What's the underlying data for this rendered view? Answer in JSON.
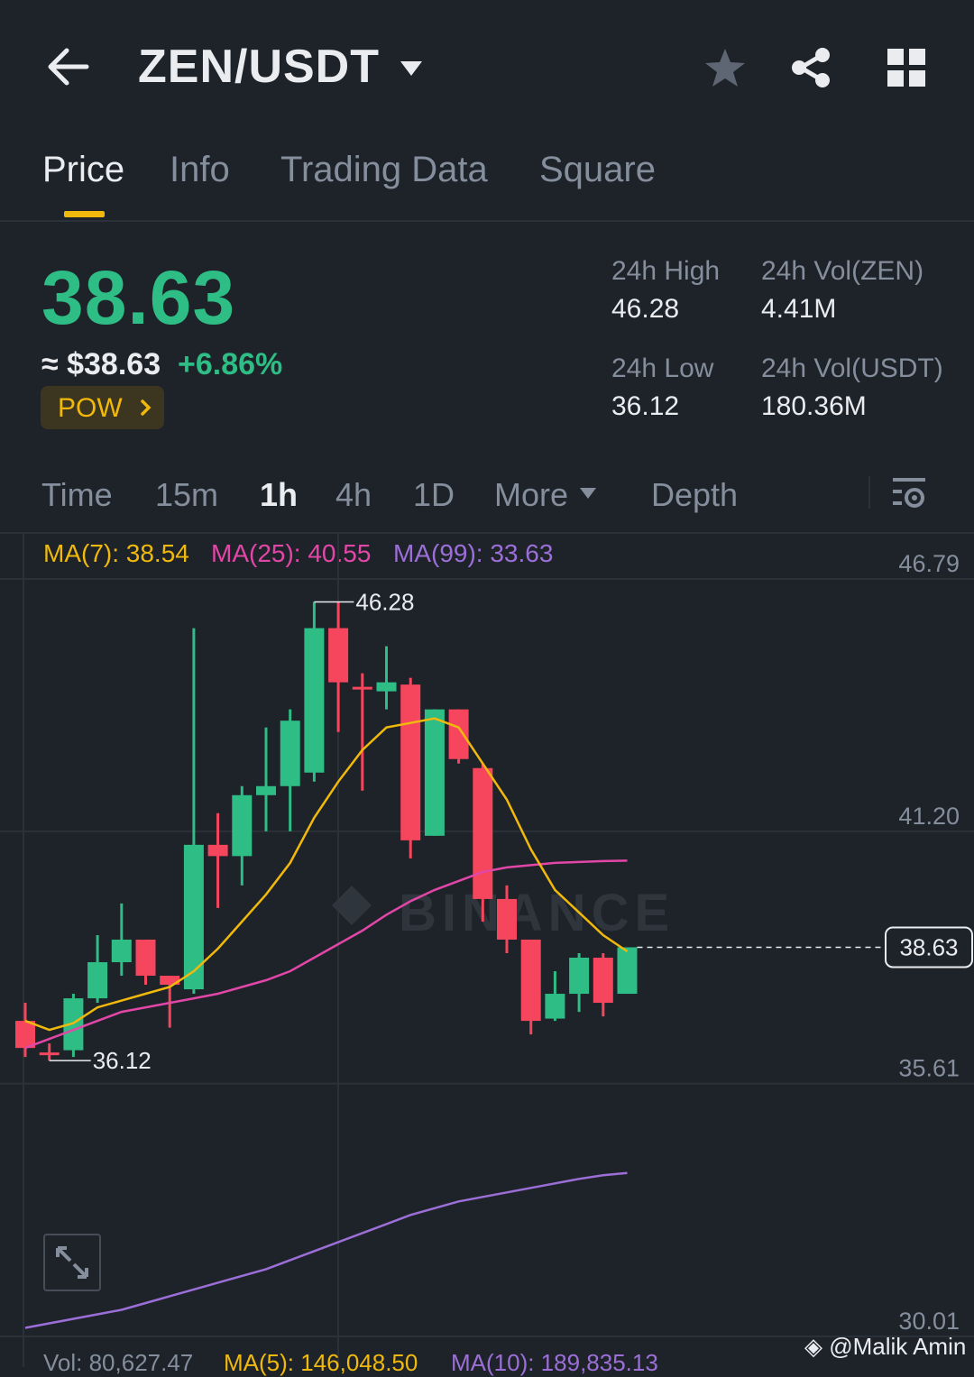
{
  "header": {
    "title": "ZEN/USDT"
  },
  "tabs": [
    {
      "label": "Price",
      "active": true
    },
    {
      "label": "Info"
    },
    {
      "label": "Trading Data"
    },
    {
      "label": "Square"
    }
  ],
  "price": {
    "last": "38.63",
    "approx": "≈ $38.63",
    "change": "+6.86%",
    "tag": "POW"
  },
  "stats": {
    "high_label": "24h High",
    "high_value": "46.28",
    "low_label": "24h Low",
    "low_value": "36.12",
    "vol_zen_label": "24h Vol(ZEN)",
    "vol_zen_value": "4.41M",
    "vol_usdt_label": "24h Vol(USDT)",
    "vol_usdt_value": "180.36M"
  },
  "timeframes": [
    {
      "label": "Time"
    },
    {
      "label": "15m"
    },
    {
      "label": "1h",
      "active": true
    },
    {
      "label": "4h"
    },
    {
      "label": "1D"
    },
    {
      "label": "More"
    },
    {
      "label": "Depth"
    }
  ],
  "indicators": {
    "ma7": "MA(7): 38.54",
    "ma25": "MA(25): 40.55",
    "ma99": "MA(99): 33.63",
    "ma7_color": "#f0b90b",
    "ma25_color": "#e247a8",
    "ma99_color": "#9c6fd8"
  },
  "chart_data": {
    "type": "candlestick",
    "y_axis_ticks": [
      "46.79",
      "41.20",
      "35.61",
      "30.01"
    ],
    "last_price_label": "38.63",
    "high_marker": "46.28",
    "low_marker": "36.12",
    "candles": [
      {
        "o": 37.0,
        "h": 37.4,
        "l": 36.2,
        "c": 36.4
      },
      {
        "o": 36.3,
        "h": 36.5,
        "l": 36.12,
        "c": 36.25
      },
      {
        "o": 36.35,
        "h": 37.6,
        "l": 36.2,
        "c": 37.5
      },
      {
        "o": 37.5,
        "h": 38.9,
        "l": 37.4,
        "c": 38.3
      },
      {
        "o": 38.3,
        "h": 39.6,
        "l": 38.0,
        "c": 38.8
      },
      {
        "o": 38.8,
        "h": 38.8,
        "l": 37.8,
        "c": 38.0
      },
      {
        "o": 38.0,
        "h": 38.0,
        "l": 36.85,
        "c": 37.8
      },
      {
        "o": 37.7,
        "h": 45.7,
        "l": 37.6,
        "c": 40.9
      },
      {
        "o": 40.9,
        "h": 41.6,
        "l": 39.5,
        "c": 40.65
      },
      {
        "o": 40.65,
        "h": 42.2,
        "l": 40.0,
        "c": 42.0
      },
      {
        "o": 42.0,
        "h": 43.5,
        "l": 41.2,
        "c": 42.2
      },
      {
        "o": 42.2,
        "h": 43.9,
        "l": 41.2,
        "c": 43.65
      },
      {
        "o": 42.5,
        "h": 46.28,
        "l": 42.3,
        "c": 45.7
      },
      {
        "o": 45.7,
        "h": 46.28,
        "l": 43.4,
        "c": 44.5
      },
      {
        "o": 44.4,
        "h": 44.7,
        "l": 42.1,
        "c": 44.35
      },
      {
        "o": 44.3,
        "h": 45.3,
        "l": 43.9,
        "c": 44.5
      },
      {
        "o": 44.45,
        "h": 44.6,
        "l": 40.6,
        "c": 41.0
      },
      {
        "o": 41.1,
        "h": 43.9,
        "l": 41.1,
        "c": 43.9
      },
      {
        "o": 43.9,
        "h": 43.9,
        "l": 42.7,
        "c": 42.8
      },
      {
        "o": 42.6,
        "h": 42.7,
        "l": 39.2,
        "c": 39.7
      },
      {
        "o": 39.7,
        "h": 40.0,
        "l": 38.5,
        "c": 38.8
      },
      {
        "o": 38.8,
        "h": 38.8,
        "l": 36.7,
        "c": 37.0
      },
      {
        "o": 37.05,
        "h": 38.1,
        "l": 37.0,
        "c": 37.6
      },
      {
        "o": 37.6,
        "h": 38.5,
        "l": 37.2,
        "c": 38.4
      },
      {
        "o": 38.4,
        "h": 38.5,
        "l": 37.1,
        "c": 37.4
      },
      {
        "o": 37.6,
        "h": 38.63,
        "l": 37.6,
        "c": 38.63
      }
    ],
    "ma7": [
      37.0,
      36.8,
      36.95,
      37.3,
      37.45,
      37.6,
      37.75,
      38.1,
      38.6,
      39.2,
      39.8,
      40.5,
      41.5,
      42.3,
      43.0,
      43.5,
      43.6,
      43.7,
      43.5,
      42.7,
      41.9,
      40.8,
      39.9,
      39.4,
      38.9,
      38.54
    ],
    "ma25": [
      36.4,
      36.6,
      36.8,
      37.0,
      37.2,
      37.3,
      37.4,
      37.5,
      37.6,
      37.75,
      37.9,
      38.1,
      38.4,
      38.7,
      39.0,
      39.35,
      39.65,
      39.9,
      40.1,
      40.3,
      40.4,
      40.45,
      40.5,
      40.52,
      40.54,
      40.55
    ],
    "ma99": [
      30.2,
      30.3,
      30.4,
      30.5,
      30.6,
      30.75,
      30.9,
      31.05,
      31.2,
      31.35,
      31.5,
      31.7,
      31.9,
      32.1,
      32.3,
      32.5,
      32.7,
      32.85,
      33.0,
      33.1,
      33.2,
      33.3,
      33.4,
      33.5,
      33.58,
      33.63
    ]
  },
  "watermark": "BINANCE",
  "credit": "@Malik Amin",
  "volume": {
    "vol": "Vol: 80,627.47",
    "ma5": "MA(5): 146,048.50",
    "ma10": "MA(10): 189,835.13"
  }
}
